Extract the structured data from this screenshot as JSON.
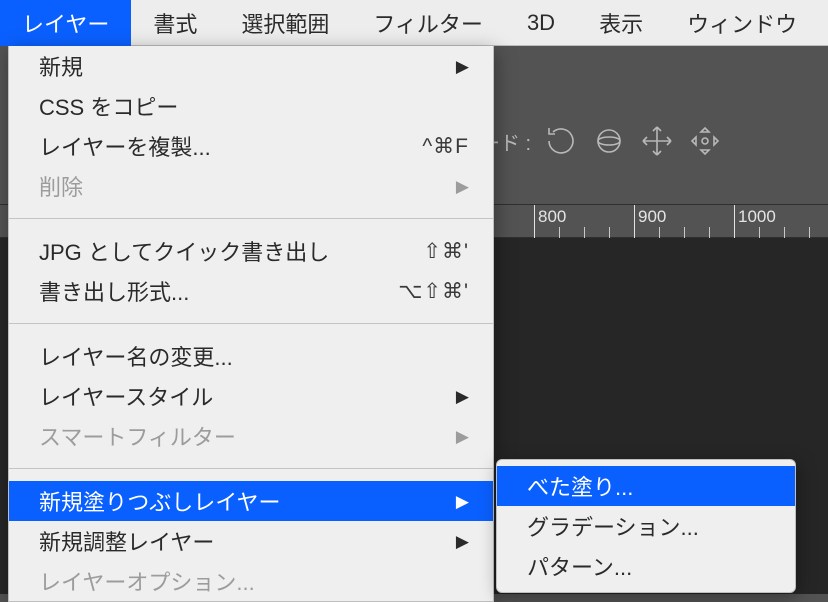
{
  "menubar": {
    "items": [
      {
        "label": "レイヤー",
        "active": true
      },
      {
        "label": "書式",
        "active": false
      },
      {
        "label": "選択範囲",
        "active": false
      },
      {
        "label": "フィルター",
        "active": false
      },
      {
        "label": "3D",
        "active": false
      },
      {
        "label": "表示",
        "active": false
      },
      {
        "label": "ウィンドウ",
        "active": false
      }
    ]
  },
  "optionbar": {
    "mode_label": "モード :"
  },
  "ruler": {
    "marks": [
      "800",
      "900",
      "1000"
    ]
  },
  "dropdown": {
    "groups": [
      [
        {
          "label": "新規",
          "submenu": true
        },
        {
          "label": "CSS をコピー"
        },
        {
          "label": "レイヤーを複製...",
          "accel": "^⌘F"
        },
        {
          "label": "削除",
          "disabled": true,
          "submenu": true
        }
      ],
      [
        {
          "label": "JPG としてクイック書き出し",
          "accel": "⇧⌘'"
        },
        {
          "label": "書き出し形式...",
          "accel": "⌥⇧⌘'"
        }
      ],
      [
        {
          "label": "レイヤー名の変更..."
        },
        {
          "label": "レイヤースタイル",
          "submenu": true
        },
        {
          "label": "スマートフィルター",
          "disabled": true,
          "submenu": true
        }
      ],
      [
        {
          "label": "新規塗りつぶしレイヤー",
          "submenu": true,
          "highlight": true
        },
        {
          "label": "新規調整レイヤー",
          "submenu": true
        },
        {
          "label": "レイヤーオプション...",
          "disabled": true
        }
      ]
    ]
  },
  "submenu": {
    "items": [
      {
        "label": "べた塗り...",
        "highlight": true
      },
      {
        "label": "グラデーション..."
      },
      {
        "label": "パターン..."
      }
    ]
  }
}
